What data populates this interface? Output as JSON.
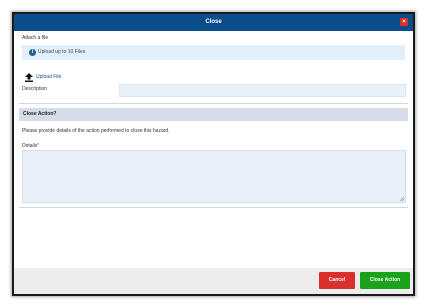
{
  "dialog": {
    "title": "Close",
    "close_glyph": "×"
  },
  "attach": {
    "label": "Attach a file",
    "info_icon": "info-icon",
    "info_text": "Upload up to 10 Files",
    "upload_icon": "upload-icon",
    "upload_link": "Upload File"
  },
  "description": {
    "label": "Description",
    "value": ""
  },
  "close_action": {
    "section_title": "Close Action?",
    "instructions": "Please provide details of the action performed to close this hazard.",
    "details_label": "Details",
    "required_marker": "*",
    "details_value": ""
  },
  "footer": {
    "cancel_label": "Cancel",
    "confirm_label": "Close Action"
  },
  "colors": {
    "titlebar": "#0a4d8c",
    "cancel": "#d9302b",
    "confirm": "#1aa31a",
    "input_bg": "#e9f0f8"
  }
}
